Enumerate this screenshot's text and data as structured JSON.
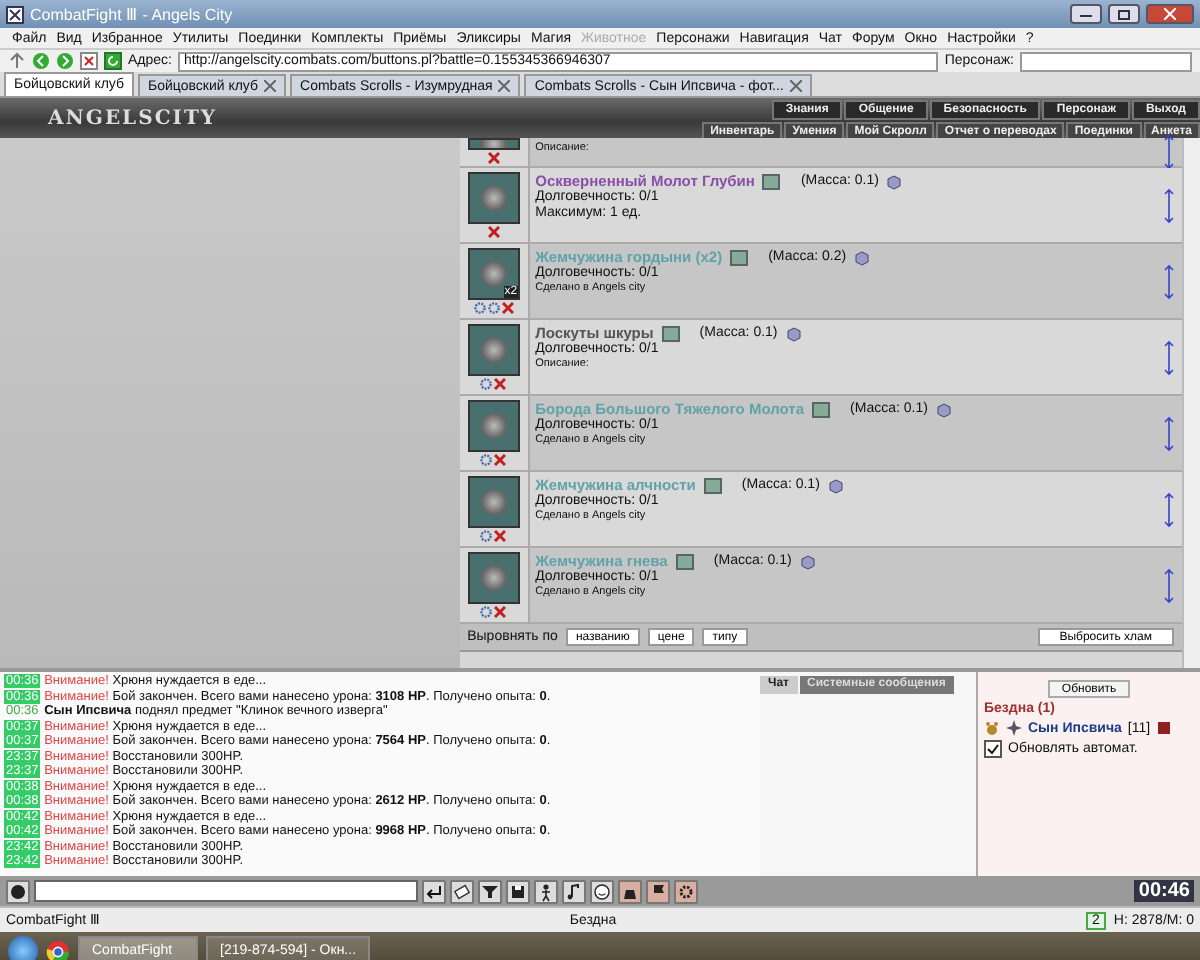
{
  "window": {
    "title": "CombatFight Ⅲ - Angels City"
  },
  "menu": [
    {
      "label": "Файл",
      "disabled": false
    },
    {
      "label": "Вид",
      "disabled": false
    },
    {
      "label": "Избранное",
      "disabled": false
    },
    {
      "label": "Утилиты",
      "disabled": false
    },
    {
      "label": "Поединки",
      "disabled": false
    },
    {
      "label": "Комплекты",
      "disabled": false
    },
    {
      "label": "Приёмы",
      "disabled": false
    },
    {
      "label": "Эликсиры",
      "disabled": false
    },
    {
      "label": "Магия",
      "disabled": false
    },
    {
      "label": "Животное",
      "disabled": true
    },
    {
      "label": "Персонажи",
      "disabled": false
    },
    {
      "label": "Навигация",
      "disabled": false
    },
    {
      "label": "Чат",
      "disabled": false
    },
    {
      "label": "Форум",
      "disabled": false
    },
    {
      "label": "Окно",
      "disabled": false
    },
    {
      "label": "Настройки",
      "disabled": false
    },
    {
      "label": "?",
      "disabled": false
    }
  ],
  "address_bar": {
    "label": "Адрес:",
    "value": "http://angelscity.combats.com/buttons.pl?battle=0.155345366946307",
    "character_label": "Персонаж:"
  },
  "tabs": [
    {
      "label": "Бойцовский клуб",
      "selected": true
    },
    {
      "label": "Бойцовский клуб",
      "selected": false
    },
    {
      "label": "Combats Scrolls - Изумрудная",
      "selected": false
    },
    {
      "label": "Combats Scrolls - Сын Ипсвича - фот...",
      "selected": false
    }
  ],
  "game_header": {
    "logo": "ANGELSCITY",
    "nav_top": [
      "Знания",
      "Общение",
      "Безопасность",
      "Персонаж",
      "Выход"
    ],
    "nav_bottom": [
      "Инвентарь",
      "Умения",
      "Мой Скролл",
      "Отчет о переводах",
      "Поединки",
      "Анкета"
    ]
  },
  "inventory": {
    "items": [
      {
        "lines": [
          "Описание:"
        ],
        "actions": [
          {
            "kind": "delete"
          }
        ]
      },
      {
        "name": "Оскверненный Молот Глубин",
        "color": "#8a4fa8",
        "mass": "(Масса: 0.1)",
        "lines": [
          "Долговечность: 0/1",
          "Максимум: 1 ед."
        ],
        "actions": [
          {
            "kind": "delete"
          }
        ]
      },
      {
        "name": "Жемчужина гордыни (x2)",
        "color": "#5fa3a8",
        "mass": "(Масса: 0.2)",
        "count": "x2",
        "lines": [
          "Долговечность: 0/1",
          "Сделано в Angels city"
        ],
        "actions": [
          {
            "kind": "gear"
          },
          {
            "kind": "gear"
          },
          {
            "kind": "delete"
          }
        ]
      },
      {
        "name": "Лоскуты шкуры",
        "color": "#555555",
        "mass": "(Масса: 0.1)",
        "lines": [
          "Долговечность: 0/1",
          "Описание:"
        ],
        "actions": [
          {
            "kind": "gear"
          },
          {
            "kind": "delete"
          }
        ]
      },
      {
        "name": "Борода Большого Тяжелого Молота",
        "color": "#5fa3a8",
        "mass": "(Масса: 0.1)",
        "lines": [
          "Долговечность: 0/1",
          "Сделано в Angels city"
        ],
        "actions": [
          {
            "kind": "gear"
          },
          {
            "kind": "delete"
          }
        ]
      },
      {
        "name": "Жемчужина алчности",
        "color": "#5fa3a8",
        "mass": "(Масса: 0.1)",
        "lines": [
          "Долговечность: 0/1",
          "Сделано в Angels city"
        ],
        "actions": [
          {
            "kind": "gear"
          },
          {
            "kind": "delete"
          }
        ]
      },
      {
        "name": "Жемчужина гнева",
        "color": "#5fa3a8",
        "mass": "(Масса: 0.1)",
        "lines": [
          "Долговечность: 0/1",
          "Сделано в Angels city"
        ],
        "actions": [
          {
            "kind": "gear"
          },
          {
            "kind": "delete"
          }
        ]
      }
    ],
    "sort_label": "Выровнять по",
    "sort_buttons": [
      "названию",
      "цене",
      "типу"
    ],
    "discard_button": "Выбросить хлам"
  },
  "chat": {
    "tabs": [
      {
        "label": "Чат",
        "selected": true
      },
      {
        "label": "Системные сообщения",
        "selected": false
      }
    ],
    "messages": [
      {
        "time": "00:36",
        "highlighted": true,
        "kind": "warning",
        "prefix": "Внимание!",
        "text": "Хрюня нуждается в еде..."
      },
      {
        "time": "00:36",
        "highlighted": true,
        "kind": "warning",
        "prefix": "Внимание!",
        "text": "Бой закончен. Всего вами нанесено урона: **3108 HP**. Получено опыта: **0**."
      },
      {
        "time": "00:36",
        "highlighted": false,
        "kind": "event",
        "text": "**Сын Ипсвича** поднял предмет \"Клинок вечного изверга\""
      },
      {
        "time": "00:37",
        "highlighted": true,
        "kind": "warning",
        "prefix": "Внимание!",
        "text": "Хрюня нуждается в еде..."
      },
      {
        "time": "00:37",
        "highlighted": true,
        "kind": "warning",
        "prefix": "Внимание!",
        "text": "Бой закончен. Всего вами нанесено урона: **7564 HP**. Получено опыта: **0**."
      },
      {
        "time": "23:37",
        "highlighted": true,
        "kind": "warning",
        "prefix": "Внимание!",
        "text": "Восстановили 300HP."
      },
      {
        "time": "23:37",
        "highlighted": true,
        "kind": "warning",
        "prefix": "Внимание!",
        "text": "Восстановили 300HP."
      },
      {
        "time": "00:38",
        "highlighted": true,
        "kind": "warning",
        "prefix": "Внимание!",
        "text": "Хрюня нуждается в еде..."
      },
      {
        "time": "00:38",
        "highlighted": true,
        "kind": "warning",
        "prefix": "Внимание!",
        "text": "Бой закончен. Всего вами нанесено урона: **2612 HP**. Получено опыта: **0**."
      },
      {
        "time": "00:42",
        "highlighted": true,
        "kind": "warning",
        "prefix": "Внимание!",
        "text": "Хрюня нуждается в еде..."
      },
      {
        "time": "00:42",
        "highlighted": true,
        "kind": "warning",
        "prefix": "Внимание!",
        "text": "Бой закончен. Всего вами нанесено урона: **9968 HP**. Получено опыта: **0**."
      },
      {
        "time": "23:42",
        "highlighted": true,
        "kind": "warning",
        "prefix": "Внимание!",
        "text": "Восстановили 300HP."
      },
      {
        "time": "23:42",
        "highlighted": true,
        "kind": "warning",
        "prefix": "Внимание!",
        "text": "Восстановили 300HP."
      }
    ]
  },
  "location_panel": {
    "refresh_button": "Обновить",
    "location": "Бездна (1)",
    "players": [
      {
        "name": "Сын Ипсвича",
        "level": "[11]"
      }
    ],
    "auto_refresh": {
      "label": "Обновлять автомат.",
      "checked": true
    }
  },
  "toolbar": {
    "clock": "00:46"
  },
  "status_bar": {
    "app": "CombatFight Ⅲ",
    "location": "Бездна",
    "badge": "2",
    "stats": "H: 2878/M: 0"
  },
  "taskbar": {
    "buttons": [
      {
        "label": "CombatFight",
        "selected": true
      },
      {
        "label": "[219-874-594] - Окн...",
        "selected": false
      }
    ]
  }
}
